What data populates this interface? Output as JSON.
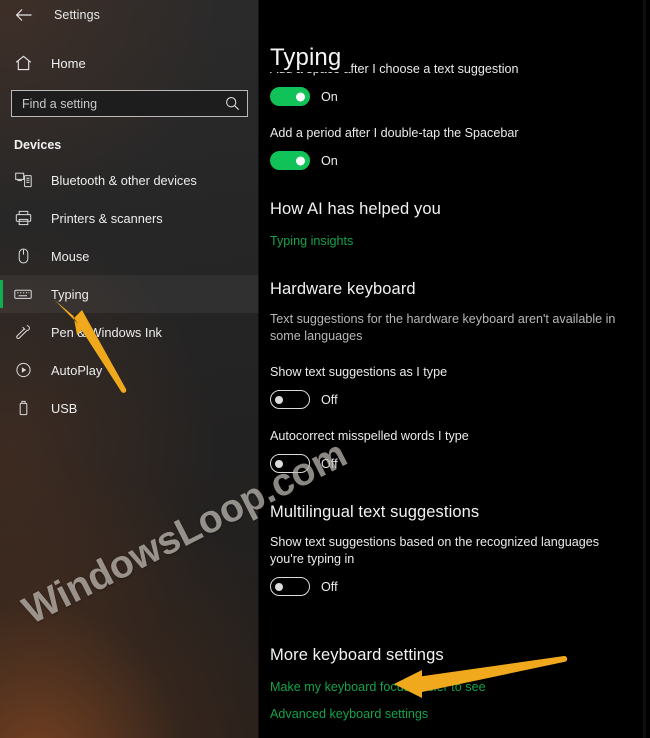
{
  "window": {
    "title": "Settings",
    "back_icon": "back-arrow-icon"
  },
  "sidebar": {
    "home": {
      "label": "Home",
      "icon": "home-icon"
    },
    "search": {
      "placeholder": "Find a setting",
      "value": "",
      "icon": "search-icon"
    },
    "group_label": "Devices",
    "items": [
      {
        "label": "Bluetooth & other devices",
        "icon": "bluetooth-devices-icon",
        "selected": false
      },
      {
        "label": "Printers & scanners",
        "icon": "printer-icon",
        "selected": false
      },
      {
        "label": "Mouse",
        "icon": "mouse-icon",
        "selected": false
      },
      {
        "label": "Typing",
        "icon": "keyboard-icon",
        "selected": true
      },
      {
        "label": "Pen & Windows Ink",
        "icon": "pen-icon",
        "selected": false
      },
      {
        "label": "AutoPlay",
        "icon": "autoplay-icon",
        "selected": false
      },
      {
        "label": "USB",
        "icon": "usb-icon",
        "selected": false
      }
    ]
  },
  "main": {
    "page_title": "Typing",
    "settings": {
      "add_space_label": "Add a space after I choose a text suggestion",
      "add_space_state": "On",
      "add_period_label": "Add a period after I double-tap the Spacebar",
      "add_period_state": "On"
    },
    "how_ai": {
      "heading": "How AI has helped you",
      "link": "Typing insights"
    },
    "hardware_keyboard": {
      "heading": "Hardware keyboard",
      "description": "Text suggestions for the hardware keyboard aren't available in some languages",
      "show_suggestions_label": "Show text suggestions as I type",
      "show_suggestions_state": "Off",
      "autocorrect_label": "Autocorrect misspelled words I type",
      "autocorrect_state": "Off"
    },
    "multilingual": {
      "heading": "Multilingual text suggestions",
      "label": "Show text suggestions based on the recognized languages you're typing in",
      "state": "Off"
    },
    "more_keyboard": {
      "heading": "More keyboard settings",
      "link_focus": "Make my keyboard focus easier to see",
      "link_advanced": "Advanced keyboard settings"
    }
  },
  "annotations": {
    "watermark": "WindowsLoop.com",
    "arrow_color": "#F0A81C",
    "accent_color": "#10AE4E",
    "link_color": "#14A34A",
    "toggle_on_color": "#10C257"
  }
}
